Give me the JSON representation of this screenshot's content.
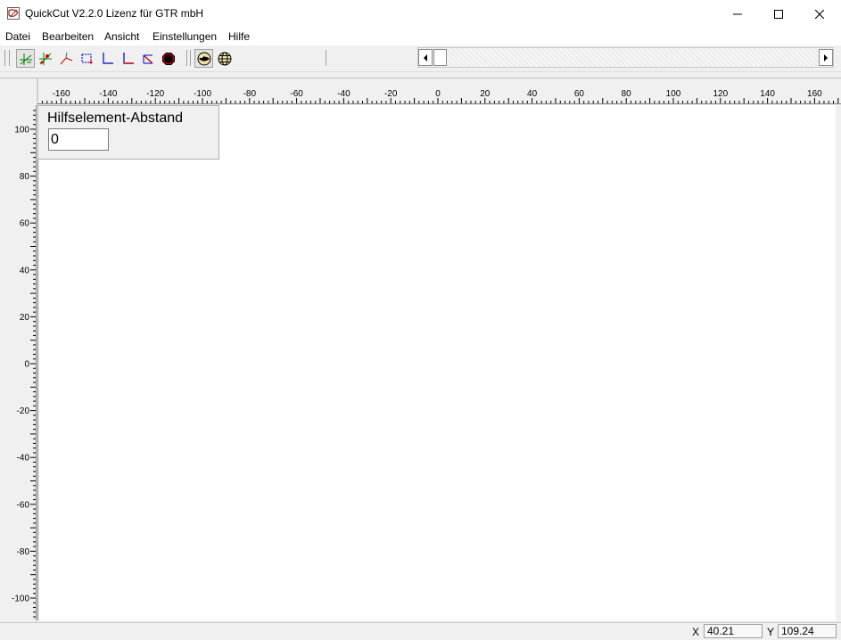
{
  "window": {
    "title": "QuickCut V2.2.0 Lizenz für GTR mbH",
    "app_icon": "quickcut-app-icon",
    "controls": [
      "minimize-icon",
      "maximize-icon",
      "close-icon"
    ]
  },
  "menu": {
    "items": [
      {
        "label": "Datei"
      },
      {
        "label": "Bearbeiten"
      },
      {
        "label": "Ansicht"
      },
      {
        "label": "Einstellungen"
      },
      {
        "label": "Hilfe"
      }
    ]
  },
  "toolbar": {
    "tools": [
      {
        "icon": "helper-line-tool-icon",
        "pressed": true
      },
      {
        "icon": "helper-point-tool-icon",
        "pressed": false
      },
      {
        "icon": "angle-line-tool-icon",
        "pressed": false
      },
      {
        "icon": "rectangle-tool-icon",
        "pressed": false
      },
      {
        "icon": "corner-tool-icon",
        "pressed": false
      },
      {
        "icon": "corner-red-tool-icon",
        "pressed": false
      },
      {
        "icon": "delete-tool-icon",
        "pressed": false
      },
      {
        "icon": "stop-icon",
        "pressed": false
      },
      {
        "icon": "ball-icon",
        "pressed": true
      },
      {
        "icon": "globe-icon",
        "pressed": false
      }
    ]
  },
  "rulers": {
    "horizontal_labels": [
      "-160",
      "-140",
      "-120",
      "-100",
      "-80",
      "-60",
      "-40",
      "-20",
      "0",
      "20",
      "40",
      "60",
      "80",
      "100",
      "120",
      "140",
      "160"
    ],
    "vertical_labels": [
      "100",
      "80",
      "60",
      "40",
      "20",
      "0",
      "-20",
      "-40",
      "-60",
      "-80",
      "-100"
    ]
  },
  "panel": {
    "title": "Hilfselement-Abstand",
    "value": "0"
  },
  "status": {
    "x_label": "X",
    "x_value": "40.21",
    "y_label": "Y",
    "y_value": "109.24"
  },
  "colors": {
    "accent_green": "#008000",
    "accent_blue": "#0000c8",
    "accent_red": "#d00000"
  }
}
